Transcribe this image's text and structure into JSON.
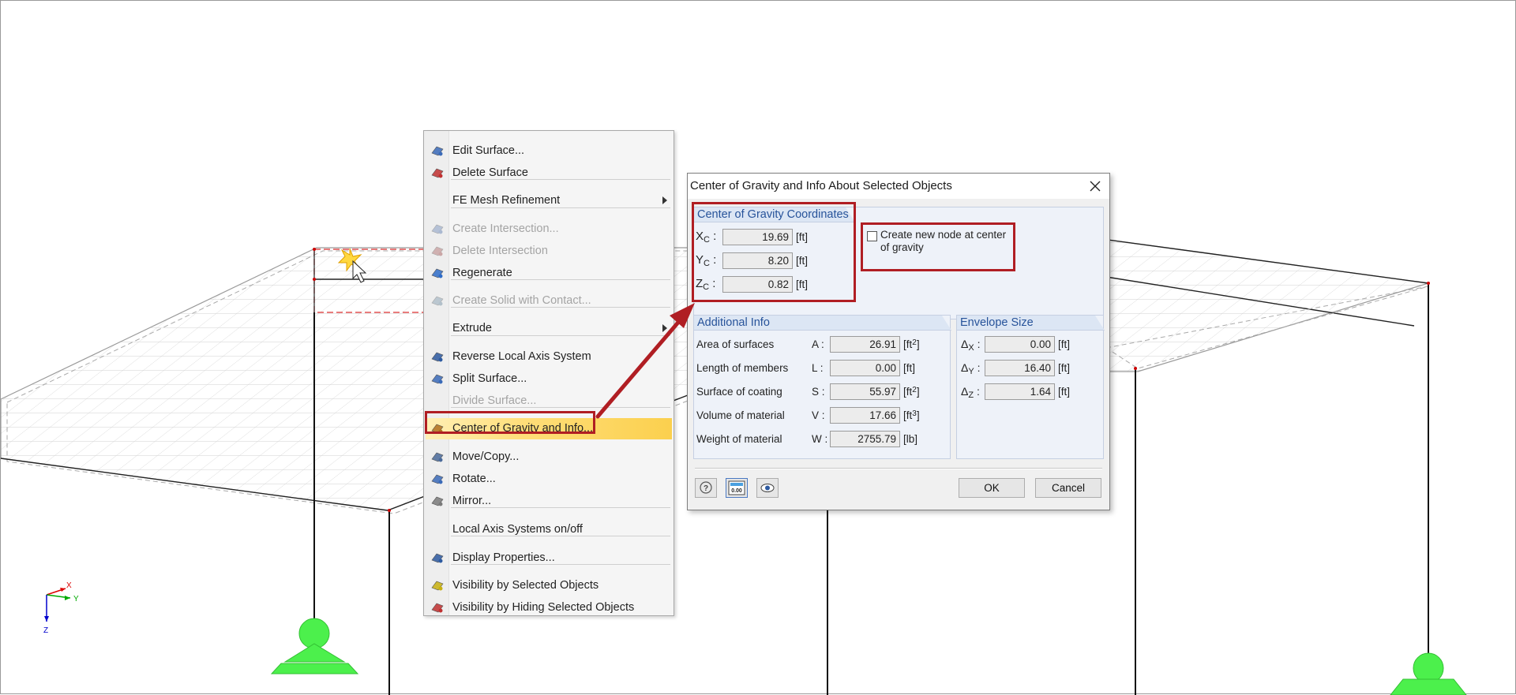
{
  "context_menu": {
    "items": [
      {
        "label": "Edit Surface...",
        "icon": "edit-surface-icon",
        "disabled": false
      },
      {
        "label": "Delete Surface",
        "icon": "delete-surface-icon",
        "disabled": false
      },
      {
        "label": "FE Mesh Refinement",
        "icon": "",
        "disabled": false,
        "submenu": true
      },
      {
        "label": "Create Intersection...",
        "icon": "create-intersection-icon",
        "disabled": true
      },
      {
        "label": "Delete Intersection",
        "icon": "delete-intersection-icon",
        "disabled": true
      },
      {
        "label": "Regenerate",
        "icon": "regenerate-icon",
        "disabled": false
      },
      {
        "label": "Create Solid with Contact...",
        "icon": "create-solid-icon",
        "disabled": true
      },
      {
        "label": "Extrude",
        "icon": "",
        "disabled": false,
        "submenu": true
      },
      {
        "label": "Reverse Local Axis System",
        "icon": "reverse-axis-icon",
        "disabled": false
      },
      {
        "label": "Split Surface...",
        "icon": "split-surface-icon",
        "disabled": false
      },
      {
        "label": "Divide Surface...",
        "icon": "",
        "disabled": true
      },
      {
        "label": "Center of Gravity and Info...",
        "icon": "center-of-gravity-icon",
        "disabled": false,
        "highlighted": true
      },
      {
        "label": "Move/Copy...",
        "icon": "move-copy-icon",
        "disabled": false
      },
      {
        "label": "Rotate...",
        "icon": "rotate-icon",
        "disabled": false
      },
      {
        "label": "Mirror...",
        "icon": "mirror-icon",
        "disabled": false
      },
      {
        "label": "Local Axis Systems on/off",
        "icon": "",
        "disabled": false
      },
      {
        "label": "Display Properties...",
        "icon": "display-properties-icon",
        "disabled": false
      },
      {
        "label": "Visibility by Selected Objects",
        "icon": "visibility-selected-icon",
        "disabled": false
      },
      {
        "label": "Visibility by Hiding Selected Objects",
        "icon": "visibility-hiding-icon",
        "disabled": false
      }
    ]
  },
  "dialog": {
    "title": "Center of Gravity and Info About Selected Objects",
    "cog_group": {
      "title": "Center of Gravity Coordinates",
      "rows": [
        {
          "axis": "X",
          "sub": "C",
          "value": "19.69",
          "unit": "[ft]"
        },
        {
          "axis": "Y",
          "sub": "C",
          "value": "8.20",
          "unit": "[ft]"
        },
        {
          "axis": "Z",
          "sub": "C",
          "value": "0.82",
          "unit": "[ft]"
        }
      ]
    },
    "checkbox": {
      "label": "Create new node at center of gravity",
      "checked": false
    },
    "additional_info": {
      "title": "Additional Info",
      "rows": [
        {
          "label": "Area of surfaces",
          "symbol": "A :",
          "value": "26.91",
          "unit": "[ft",
          "exp": "2",
          "close": "]"
        },
        {
          "label": "Length of members",
          "symbol": "L :",
          "value": "0.00",
          "unit": "[ft]",
          "exp": "",
          "close": ""
        },
        {
          "label": "Surface of coating",
          "symbol": "S :",
          "value": "55.97",
          "unit": "[ft",
          "exp": "2",
          "close": "]"
        },
        {
          "label": "Volume of material",
          "symbol": "V :",
          "value": "17.66",
          "unit": "[ft",
          "exp": "3",
          "close": "]"
        },
        {
          "label": "Weight of material",
          "symbol": "W :",
          "value": "2755.79",
          "unit": "[lb]",
          "exp": "",
          "close": ""
        }
      ]
    },
    "envelope": {
      "title": "Envelope Size",
      "rows": [
        {
          "delta": "Δ",
          "axis": "X",
          "value": "0.00",
          "unit": "[ft]"
        },
        {
          "delta": "Δ",
          "axis": "Y",
          "value": "16.40",
          "unit": "[ft]"
        },
        {
          "delta": "Δ",
          "axis": "Z",
          "value": "1.64",
          "unit": "[ft]"
        }
      ]
    },
    "buttons": {
      "ok": "OK",
      "cancel": "Cancel"
    },
    "tools": [
      "help-icon",
      "units-icon",
      "view-icon"
    ]
  },
  "viewport": {
    "axes": {
      "x": "X",
      "y": "Y",
      "z": "Z"
    }
  },
  "colors": {
    "accent_red": "#b01e23",
    "group_title": "#27539a",
    "highlight": "#fbd04e",
    "support_green": "#4cf04c"
  }
}
